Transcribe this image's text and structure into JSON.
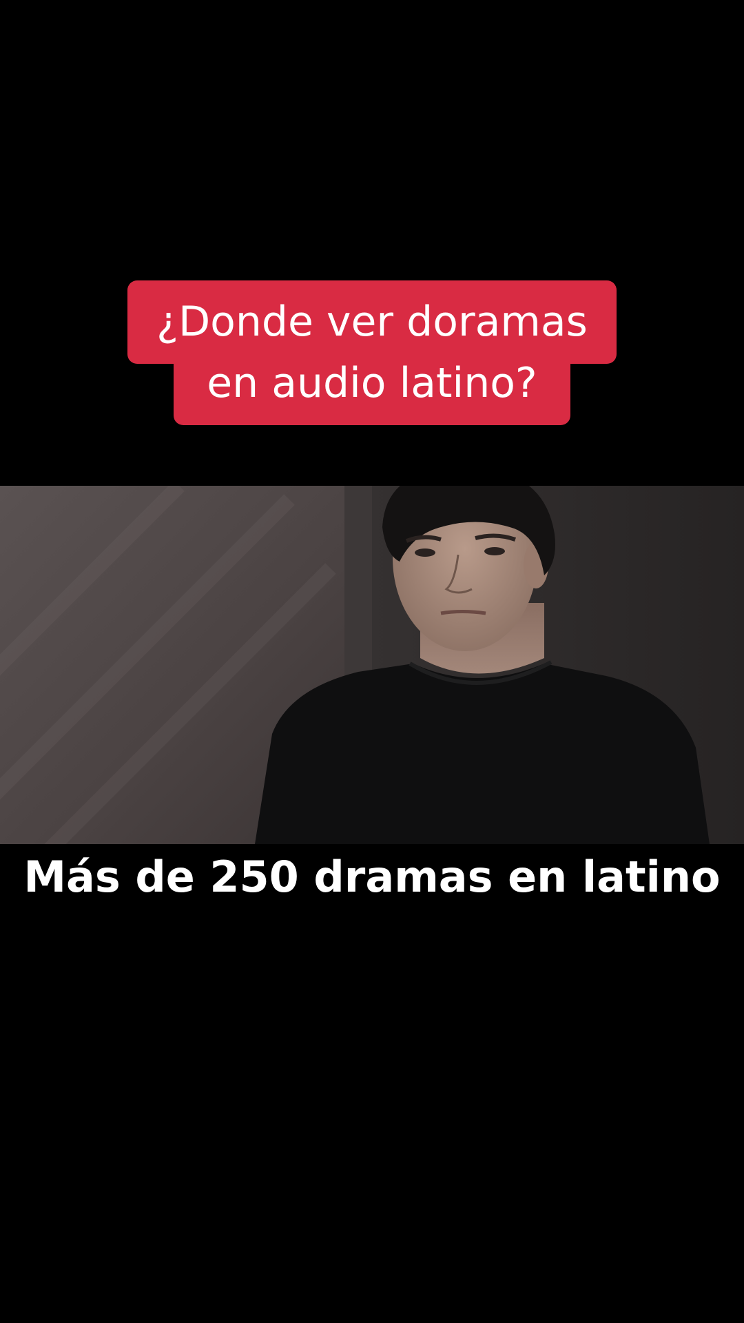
{
  "caption": {
    "line1": "¿Donde ver doramas",
    "line2": "en audio latino?",
    "background_color": "#d92b43"
  },
  "video": {
    "scene": "man-in-black-tshirt-icon"
  },
  "subtitle": {
    "text": "Más de 250 dramas en latino"
  }
}
